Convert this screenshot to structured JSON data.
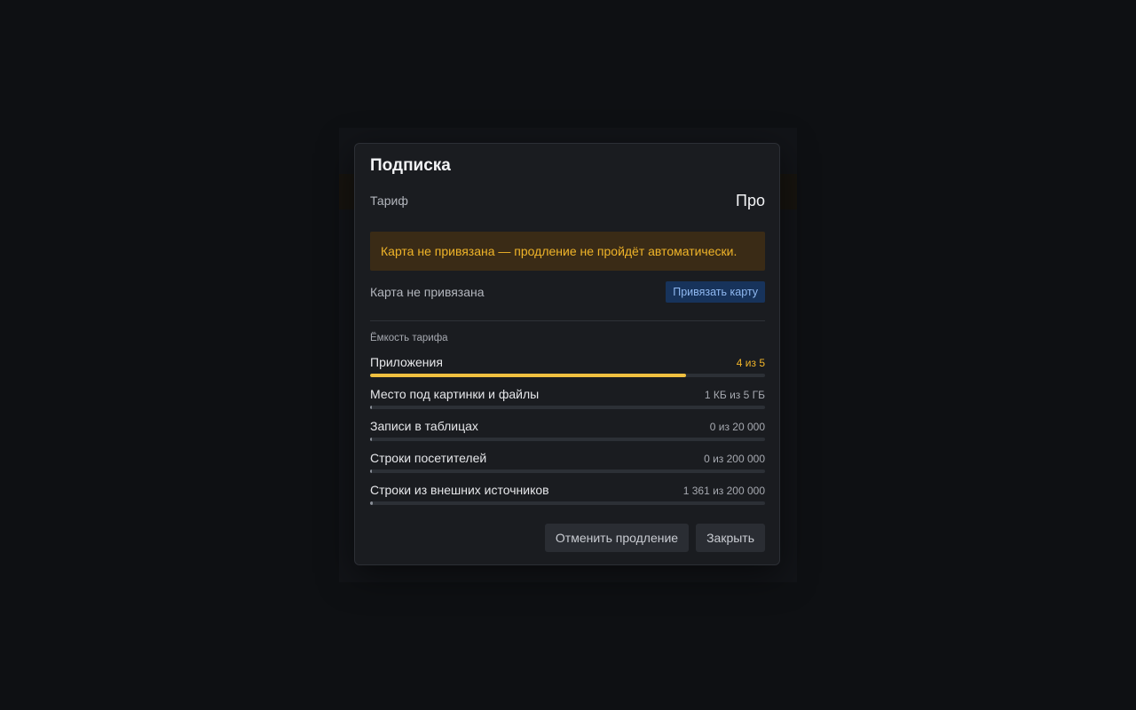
{
  "modal": {
    "title": "Подписка",
    "plan_label": "Тариф",
    "plan_value": "Про",
    "warning_text": "Карта не привязана — продление не пройдёт автоматически.",
    "card_status": "Карта не привязана",
    "bind_card_label": "Привязать карту",
    "capacity_label": "Ёмкость тарифа",
    "usage": [
      {
        "name": "Приложения",
        "value_text": "4 из 5",
        "fraction": 0.8,
        "warn": true
      },
      {
        "name": "Место под картинки и файлы",
        "value_text": "1 КБ из 5 ГБ",
        "fraction": 0.0,
        "warn": false
      },
      {
        "name": "Записи в таблицах",
        "value_text": "0 из 20 000",
        "fraction": 0.0,
        "warn": false
      },
      {
        "name": "Строки посетителей",
        "value_text": "0 из 200 000",
        "fraction": 0.0,
        "warn": false
      },
      {
        "name": "Строки из внешних источников",
        "value_text": "1 361 из 200 000",
        "fraction": 0.0068,
        "warn": false
      }
    ],
    "cancel_renewal_label": "Отменить продление",
    "close_label": "Закрыть"
  },
  "colors": {
    "warning": "#f0b429",
    "accent_blue": "#17335b"
  }
}
